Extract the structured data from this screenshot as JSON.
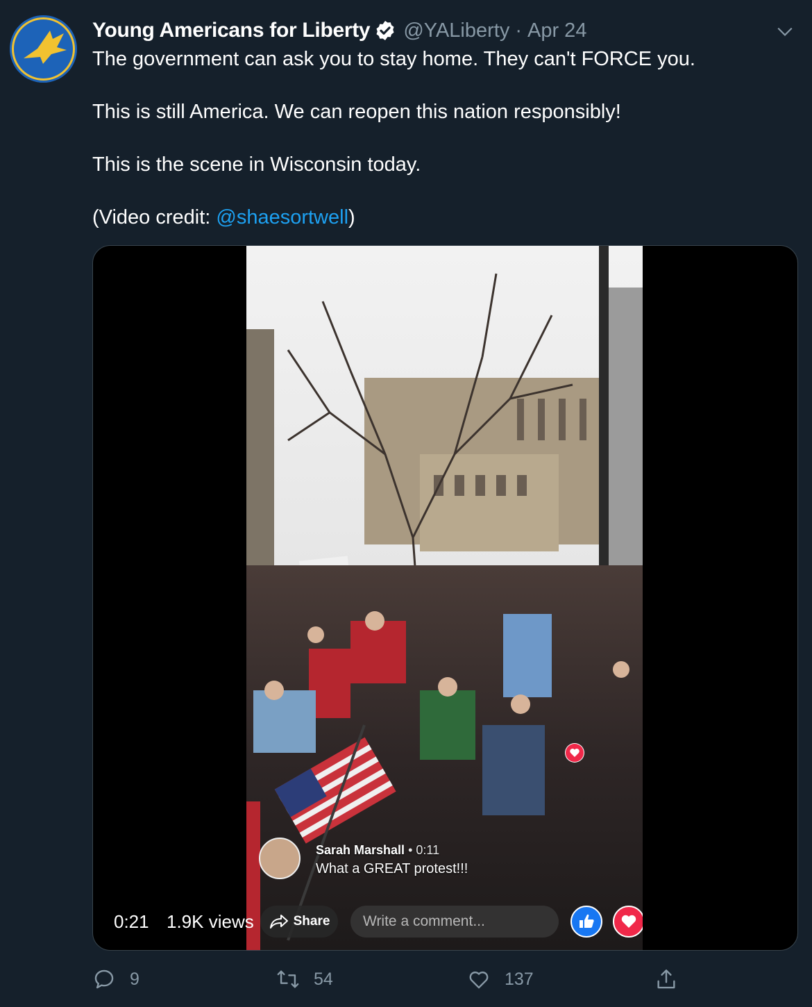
{
  "tweet": {
    "display_name": "Young Americans for Liberty",
    "verified_icon": "verified-badge-icon",
    "handle": "@YALiberty",
    "separator": "·",
    "date": "Apr 24",
    "text_line1": "The government can ask you to stay home. They can't FORCE you.",
    "text_line2": "This is still America. We can reopen this nation responsibly!",
    "text_line3": "This is the scene in Wisconsin today.",
    "credit_prefix": "(Video credit: ",
    "credit_mention": "@shaesortwell",
    "credit_suffix": ")"
  },
  "video": {
    "current_time": "0:21",
    "views": "1.9K views",
    "fb_share_label": "Share",
    "fb_comment_placeholder": "Write a comment...",
    "fb_comment_author": "Sarah Marshall",
    "fb_comment_separator": "•",
    "fb_comment_time": "0:11",
    "fb_comment_text": "What a GREAT protest!!!"
  },
  "actions": {
    "replies": "9",
    "retweets": "54",
    "likes": "137"
  },
  "colors": {
    "background": "#15202b",
    "secondary_text": "#8899a6",
    "link": "#1da1f2",
    "border": "#38444d"
  }
}
